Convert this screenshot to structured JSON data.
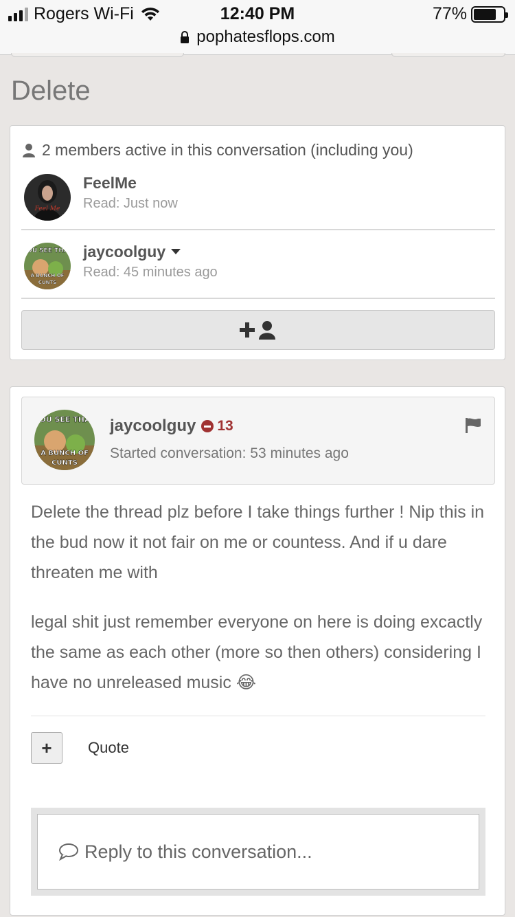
{
  "status_bar": {
    "carrier": "Rogers Wi-Fi",
    "time": "12:40 PM",
    "battery": "77%",
    "battery_level": 0.77,
    "url": "pophatesflops.com"
  },
  "page_title": "Delete",
  "members": {
    "header": "2 members active in this conversation (including you)",
    "list": [
      {
        "name": "FeelMe",
        "read": "Read: Just now",
        "avatar": "woman-portrait-avatar"
      },
      {
        "name": "jaycoolguy",
        "read": "Read: 45 minutes ago",
        "avatar": "toy-story-meme-avatar",
        "avatar_text_top": "YOU SEE THAT",
        "avatar_text_bottom": "A BUNCH OF CUNTS"
      }
    ],
    "add_button_icon": "add-user-icon"
  },
  "message": {
    "author": "jaycoolguy",
    "reputation": "13",
    "started": "Started conversation: 53 minutes ago",
    "avatar_text_top": "YOU SEE THAT",
    "avatar_text_bottom": "A BUNCH OF CUNTS",
    "paragraph1": "Delete the thread plz before I take things further ! Nip this in the bud now it not fair on me or countess. And if u dare threaten me with",
    "paragraph2": "legal shit just remember everyone on here is doing excactly the same as each other (more so then others) considering I have no unreleased music",
    "emoji": "😂",
    "plus_label": "+",
    "quote_label": "Quote",
    "reply_placeholder": "Reply to this conversation..."
  },
  "colors": {
    "background": "#e9e6e4",
    "card": "#ffffff",
    "negative": "#a03232"
  }
}
